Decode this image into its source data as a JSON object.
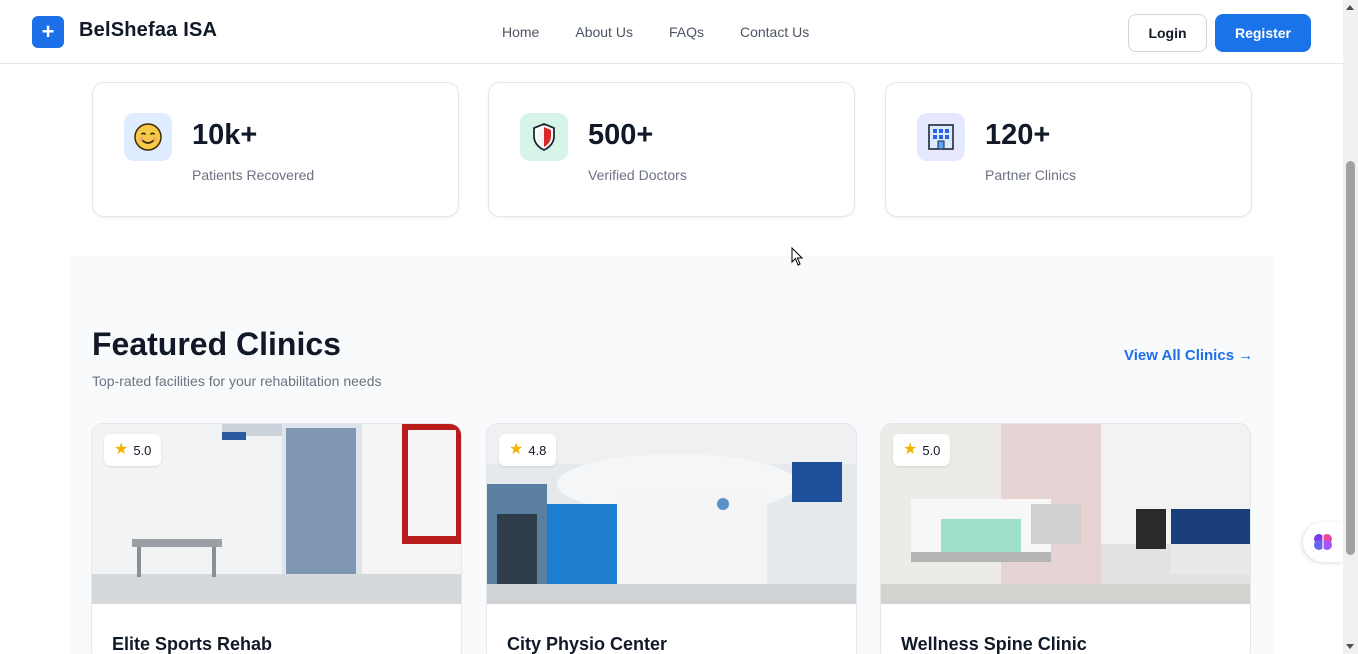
{
  "navbar": {
    "logo_symbol": "+",
    "brand": "BelShefaa ISA",
    "links": [
      "Home",
      "About Us",
      "FAQs",
      "Contact Us"
    ],
    "login_label": "Login",
    "register_label": "Register"
  },
  "stats": [
    {
      "value": "10k+",
      "label": "Patients Recovered",
      "icon": "smiling-face-icon"
    },
    {
      "value": "500+",
      "label": "Verified Doctors",
      "icon": "shield-icon"
    },
    {
      "value": "120+",
      "label": "Partner Clinics",
      "icon": "building-icon"
    }
  ],
  "featured": {
    "title": "Featured Clinics",
    "subtitle": "Top-rated facilities for your rehabilitation needs",
    "view_all": "View All Clinics →",
    "clinics": [
      {
        "name": "Elite Sports Rehab",
        "rating": "5.0"
      },
      {
        "name": "City Physio Center",
        "rating": "4.8"
      },
      {
        "name": "Wellness Spine Clinic",
        "rating": "5.0"
      }
    ]
  },
  "colors": {
    "accent": "#1a73e8",
    "background_section": "#f8fafc",
    "star": "#f5b301"
  }
}
